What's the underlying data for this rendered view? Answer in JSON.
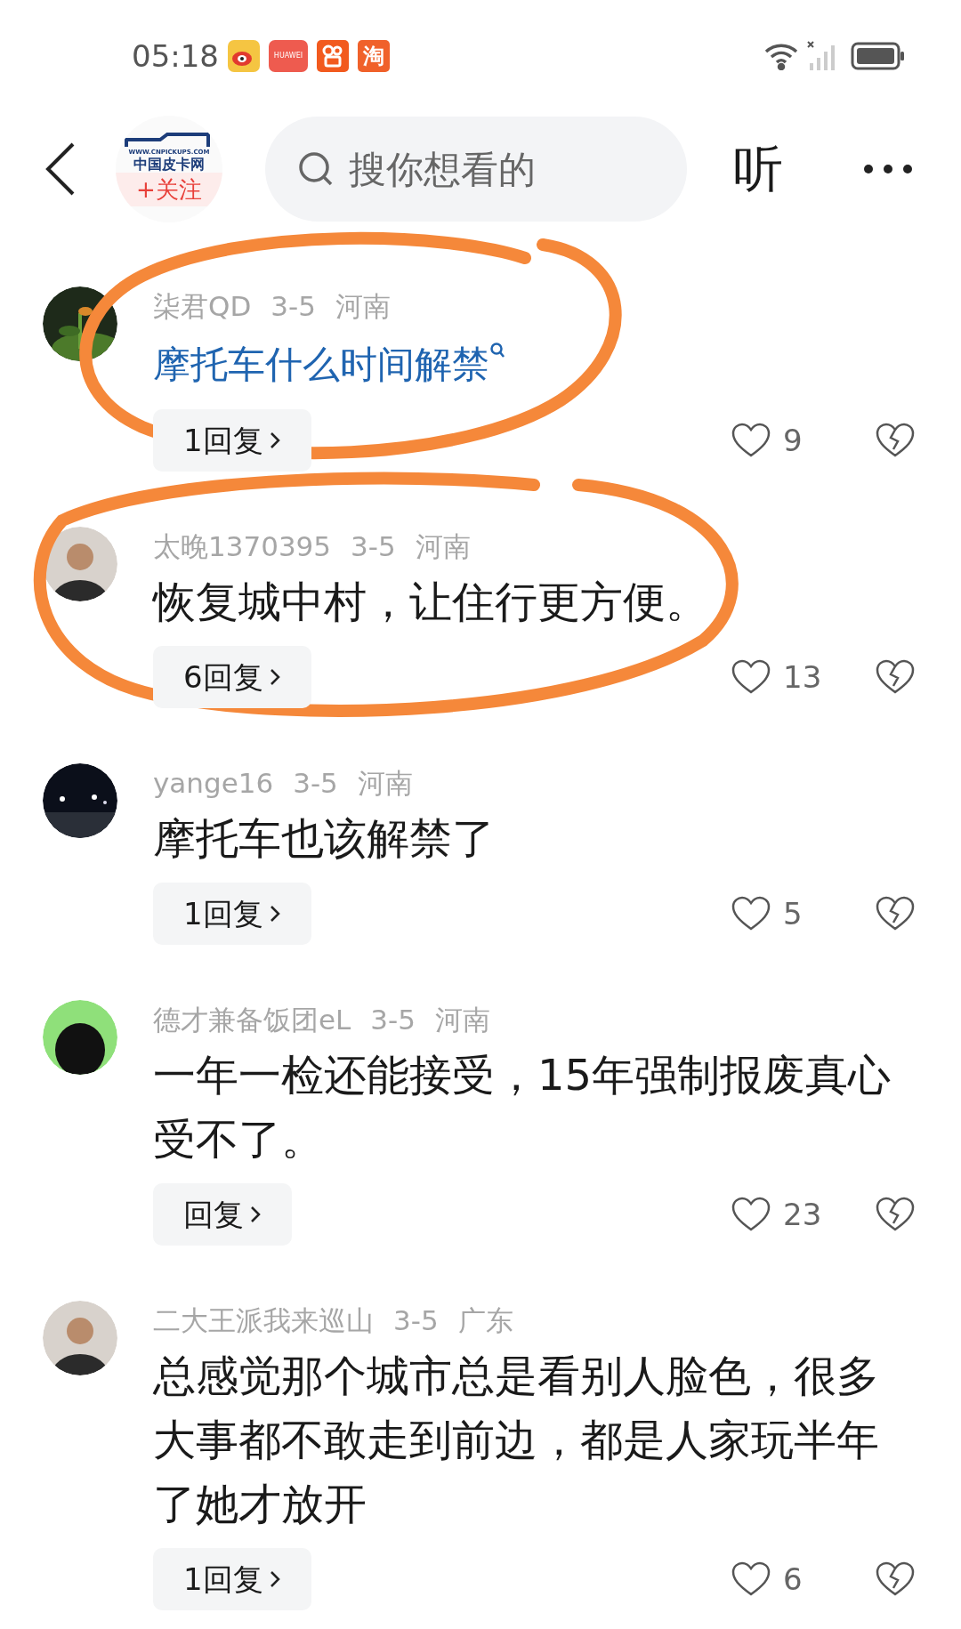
{
  "status_bar": {
    "time": "05:18",
    "app_icons": [
      {
        "kind": "weibo"
      },
      {
        "kind": "huawei",
        "label": "HUAWEI"
      },
      {
        "kind": "kuaishou"
      },
      {
        "kind": "taobao",
        "label": "淘"
      }
    ]
  },
  "header": {
    "account": {
      "site": "WWW.CNPICKUPS.COM",
      "name": "中国皮卡网",
      "follow": "+关注"
    },
    "search": {
      "placeholder": "搜你想看的"
    },
    "listen": "听"
  },
  "comments": [
    {
      "user": "柒君QD",
      "date": "3-5",
      "region": "河南",
      "kind": "link",
      "text": "摩托车什么时间解禁",
      "replies": "1回复",
      "likes": "9",
      "circled": true
    },
    {
      "user": "太晚1370395",
      "date": "3-5",
      "region": "河南",
      "kind": "text",
      "text": "恢复城中村，让住行更方便。",
      "replies": "6回复",
      "likes": "13",
      "circled": true
    },
    {
      "user": "yange16",
      "date": "3-5",
      "region": "河南",
      "kind": "text",
      "text": "摩托车也该解禁了",
      "replies": "1回复",
      "likes": "5",
      "circled": false
    },
    {
      "user": "德才兼备饭团eL",
      "date": "3-5",
      "region": "河南",
      "kind": "text",
      "text": "一年一检还能接受，15年强制报废真心受不了。",
      "replies": "回复",
      "likes": "23",
      "circled": false
    },
    {
      "user": "二大王派我来巡山",
      "date": "3-5",
      "region": "广东",
      "kind": "text",
      "text": "总感觉那个城市总是看别人脸色，很多大事都不敢走到前边，都是人家玩半年了她才放开",
      "replies": "1回复",
      "likes": "6",
      "circled": false
    }
  ]
}
